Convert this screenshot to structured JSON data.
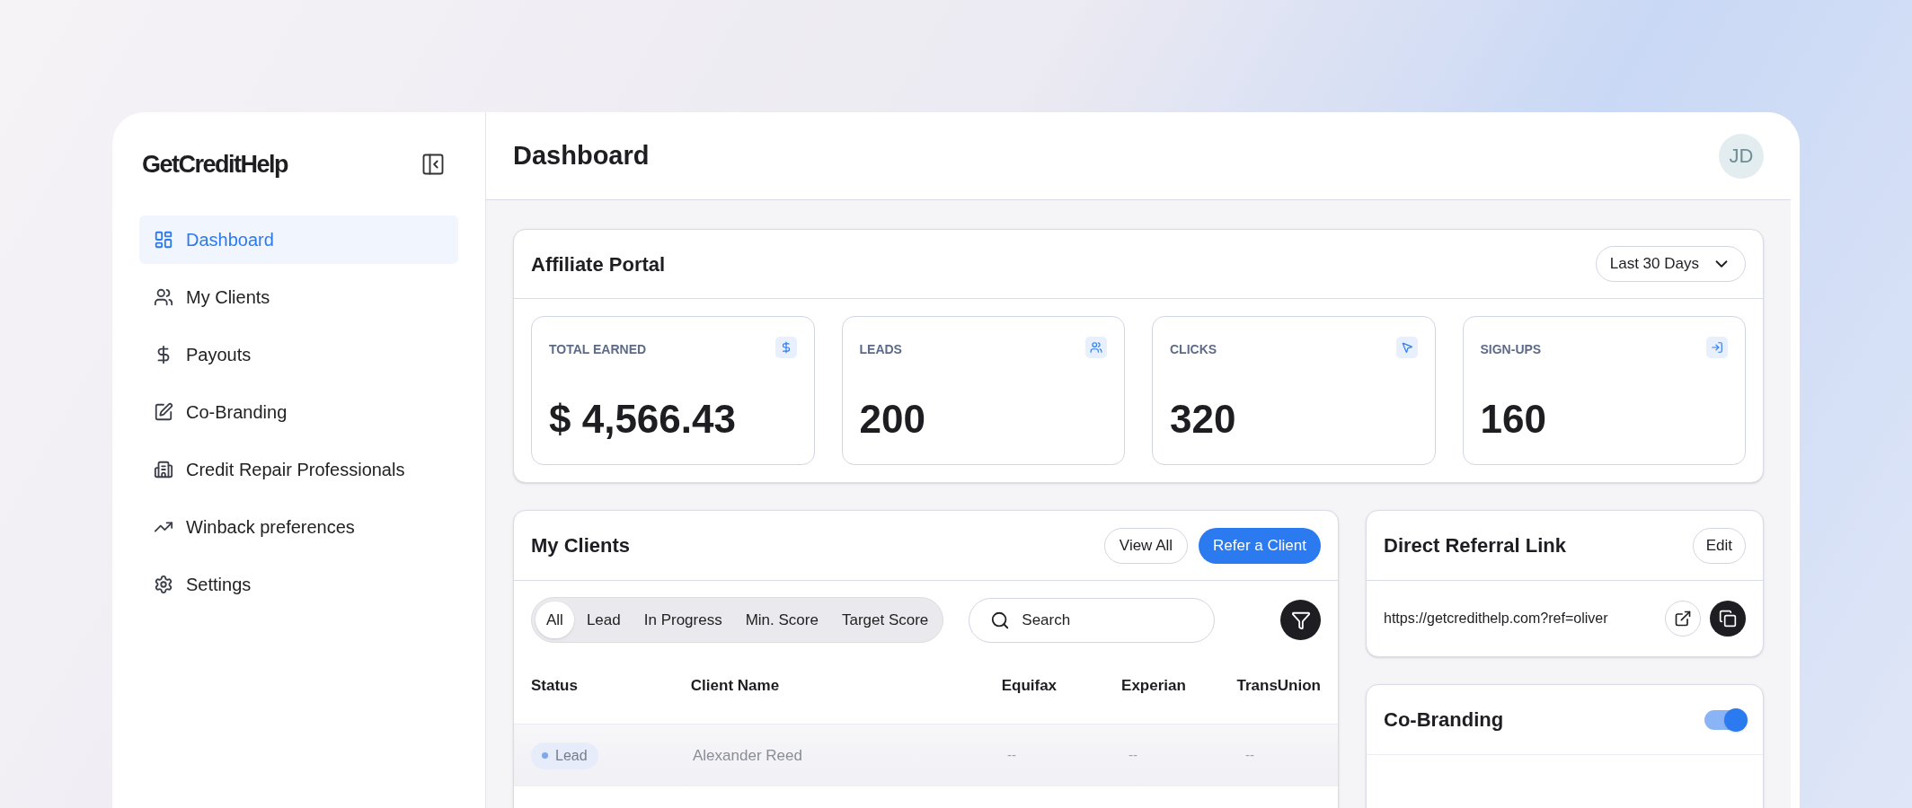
{
  "sidebar": {
    "logo": "GetCreditHelp",
    "items": [
      {
        "label": "Dashboard",
        "selected": true
      },
      {
        "label": "My Clients",
        "selected": false
      },
      {
        "label": "Payouts",
        "selected": false
      },
      {
        "label": "Co-Branding",
        "selected": false
      },
      {
        "label": "Credit Repair Professionals",
        "selected": false
      },
      {
        "label": "Winback preferences",
        "selected": false
      },
      {
        "label": "Settings",
        "selected": false
      }
    ]
  },
  "header": {
    "title": "Dashboard",
    "avatar": "JD"
  },
  "affiliate_portal": {
    "title": "Affiliate Portal",
    "range": "Last 30 Days",
    "stats": [
      {
        "label": "TOTAL EARNED",
        "value": "$ 4,566.43"
      },
      {
        "label": "LEADS",
        "value": "200"
      },
      {
        "label": "CLICKS",
        "value": "320"
      },
      {
        "label": "SIGN-UPS",
        "value": "160"
      }
    ]
  },
  "my_clients": {
    "title": "My Clients",
    "view_all": "View All",
    "refer": "Refer a Client",
    "filters": [
      {
        "label": "All",
        "selected": true
      },
      {
        "label": "Lead",
        "selected": false
      },
      {
        "label": "In Progress",
        "selected": false
      },
      {
        "label": "Min. Score",
        "selected": false
      },
      {
        "label": "Target Score",
        "selected": false
      }
    ],
    "search": {
      "placeholder": "Search"
    },
    "columns": [
      "Status",
      "Client Name",
      "Equifax",
      "Experian",
      "TransUnion"
    ],
    "rows": [
      {
        "status": "Lead",
        "name": "Alexander Reed",
        "equifax": "--",
        "experian": "--",
        "transunion": "--"
      }
    ]
  },
  "referral": {
    "title": "Direct Referral Link",
    "edit": "Edit",
    "url": "https://getcredithelp.com?ref=oliver"
  },
  "co_branding": {
    "title": "Co-Branding",
    "on": true
  }
}
